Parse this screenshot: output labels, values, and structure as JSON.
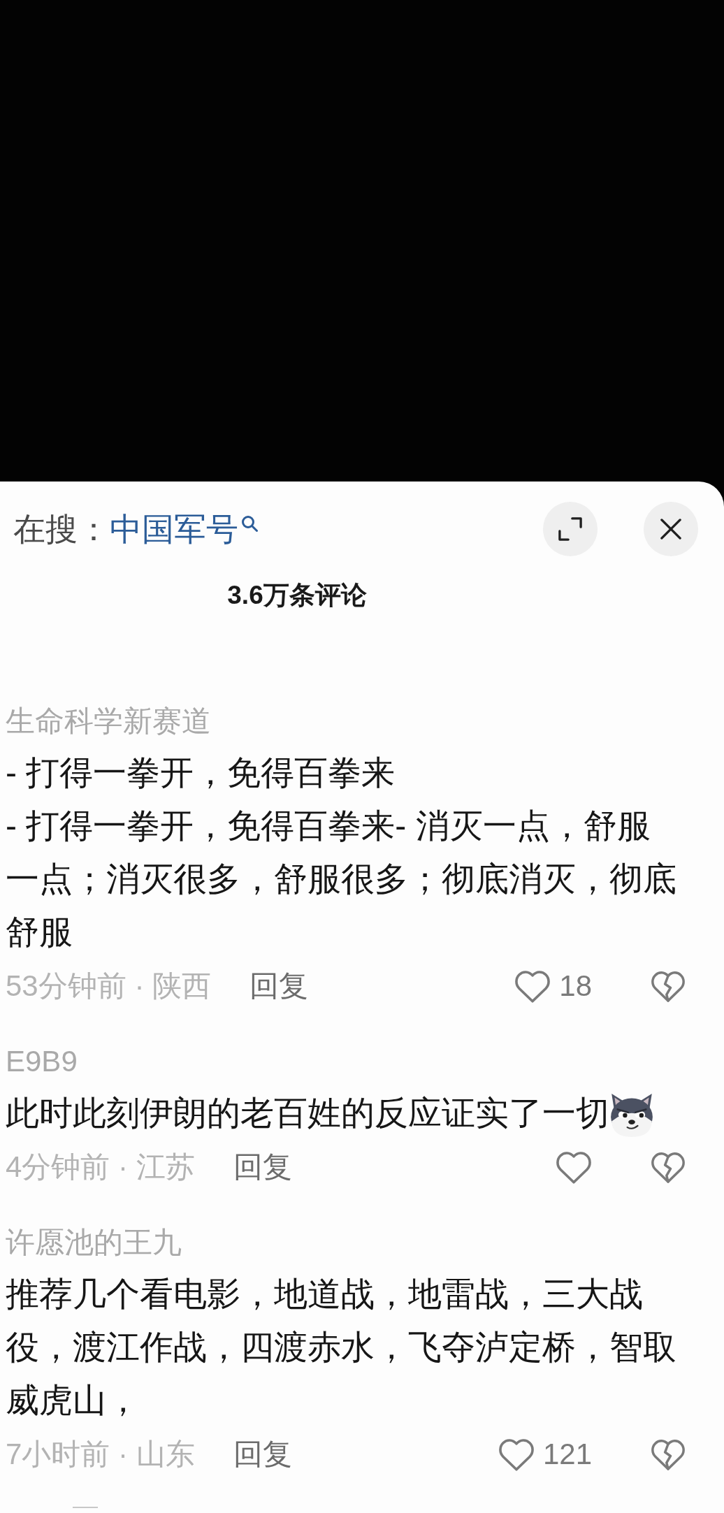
{
  "search_bar": {
    "label": "在搜：",
    "query": "中国军号"
  },
  "sheet": {
    "title": "3.6万条评论"
  },
  "comments": [
    {
      "user": "生命科学新赛道",
      "text": "- 打得一拳开，免得百拳来\n- 打得一拳开，免得百拳来- 消灭一点，舒服一点；消灭很多，舒服很多；彻底消灭，彻底舒服",
      "sticker": false,
      "meta": "53分钟前 · 陕西",
      "reply": "回复",
      "likes": "18"
    },
    {
      "user": "E9B9",
      "text": "此时此刻伊朗的老百姓的反应证实了一切",
      "sticker": true,
      "meta": "4分钟前 · 江苏",
      "reply": "回复"
    },
    {
      "user": "许愿池的王九",
      "text": "推荐几个看电影，地道战，地雷战，三大战役，渡江作战，四渡赤水，飞夺泸定桥，智取威虎山，",
      "sticker": false,
      "meta": "7小时前 · 山东",
      "reply": "回复",
      "likes": "121"
    }
  ]
}
